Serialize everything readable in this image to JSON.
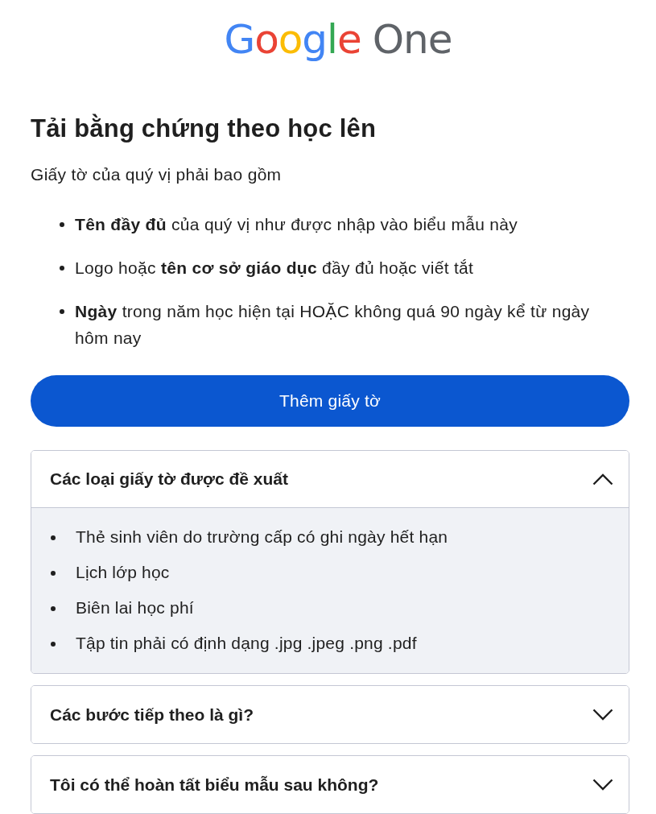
{
  "logo": {
    "brand": "Google",
    "product": "One"
  },
  "title": "Tải bằng chứng theo học lên",
  "intro": "Giấy tờ của quý vị phải bao gồm",
  "requirements": [
    "**Tên đầy đủ** của quý vị như được nhập vào biểu mẫu này",
    "Logo hoặc **tên cơ sở giáo dục** đầy đủ hoặc viết tắt",
    "**Ngày** trong năm học hiện tại HOẶC không quá 90 ngày kể từ ngày hôm nay"
  ],
  "add_button": {
    "label": "Thêm giấy tờ"
  },
  "faq": [
    {
      "title": "Các loại giấy tờ được đề xuất",
      "expanded": true,
      "items": [
        "Thẻ sinh viên do trường cấp có ghi ngày hết hạn",
        "Lịch lớp học",
        "Biên lai học phí",
        "Tập tin phải có định dạng .jpg .jpeg .png .pdf"
      ]
    },
    {
      "title": "Các bước tiếp theo là gì?",
      "expanded": false
    },
    {
      "title": "Tôi có thể hoàn tất biểu mẫu sau không?",
      "expanded": false
    }
  ]
}
